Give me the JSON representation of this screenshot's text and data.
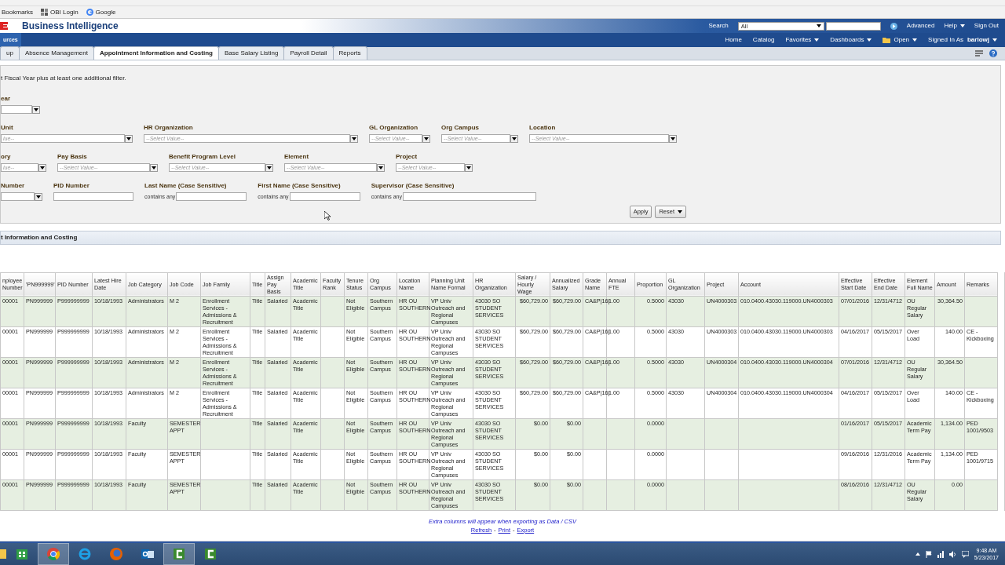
{
  "bookmarks": [
    {
      "label": "Bookmarks",
      "kind": "plain"
    },
    {
      "label": "OBI Login",
      "kind": "grid"
    },
    {
      "label": "Google",
      "kind": "google"
    }
  ],
  "header": {
    "title": "Business Intelligence",
    "search_label": "Search",
    "search_scope": "All",
    "links": [
      {
        "label": "Advanced",
        "menu": false
      },
      {
        "label": "Help",
        "menu": true
      },
      {
        "label": "Sign Out",
        "menu": false
      }
    ]
  },
  "nav": {
    "left": "urces",
    "items": [
      {
        "label": "Home",
        "menu": false
      },
      {
        "label": "Catalog",
        "menu": false
      },
      {
        "label": "Favorites",
        "menu": true
      },
      {
        "label": "Dashboards",
        "menu": true
      },
      {
        "label": "Open",
        "menu": true
      },
      {
        "label": "Signed In As",
        "menu": false
      }
    ],
    "user": "barlowj"
  },
  "tabs": [
    {
      "label": "up",
      "selected": false
    },
    {
      "label": "Absence Management",
      "selected": false
    },
    {
      "label": "Appointment Information and Costing",
      "selected": true
    },
    {
      "label": "Base Salary Listing",
      "selected": false
    },
    {
      "label": "Payroll Detail",
      "selected": false
    },
    {
      "label": "Reports",
      "selected": false
    }
  ],
  "instruction": "t Fiscal Year plus at least one additional filter.",
  "filters": [
    [
      {
        "label": "ear",
        "kind": "select"
      }
    ],
    [
      {
        "label": "Unit",
        "kind": "select",
        "placeholder": "lue--"
      },
      {
        "label": "HR Organization",
        "kind": "select",
        "placeholder": "--Select Value--"
      },
      {
        "label": "GL Organization",
        "kind": "select",
        "placeholder": "--Select Value--"
      },
      {
        "label": "Org Campus",
        "kind": "select",
        "placeholder": "--Select Value--"
      },
      {
        "label": "Location",
        "kind": "select",
        "placeholder": "--Select Value--"
      }
    ],
    [
      {
        "label": "ory",
        "kind": "select",
        "placeholder": "lue--"
      },
      {
        "label": "Pay Basis",
        "kind": "select",
        "placeholder": "--Select Value--"
      },
      {
        "label": "Benefit Program Level",
        "kind": "select",
        "placeholder": "--Select Value--"
      },
      {
        "label": "Element",
        "kind": "select",
        "placeholder": "--Select Value--"
      },
      {
        "label": "Project",
        "kind": "select",
        "placeholder": "--Select Value--"
      }
    ],
    [
      {
        "label": "Number",
        "kind": "select"
      },
      {
        "label": "PID Number",
        "kind": "text"
      },
      {
        "label": "Last Name (Case Sensitive)",
        "kind": "contains",
        "operator": "contains any"
      },
      {
        "label": "First Name (Case Sensitive)",
        "kind": "contains",
        "operator": "contains any"
      },
      {
        "label": "Supervisor (Case Sensitive)",
        "kind": "contains",
        "operator": "contains any"
      }
    ]
  ],
  "buttons": [
    {
      "label": "Apply",
      "menu": false
    },
    {
      "label": "Reset",
      "menu": true
    }
  ],
  "section_title": "t Information and Costing",
  "table": {
    "columns": [
      "nployee Number",
      "'PN999999'",
      "PID Number",
      "Latest Hire Date",
      "Job Category",
      "Job Code",
      "Job Family",
      "Title",
      "Assign Pay Basis",
      "Academic Title",
      "Faculty Rank",
      "Tenure Status",
      "Org Campus",
      "Location Name",
      "Planning Unit Name Formal",
      "HR Organization",
      "Salary / Hourly Wage",
      "Annualized Salary",
      "Grade Name",
      "Annual FTE",
      "Proportion",
      "GL Organization",
      "Project",
      "Account",
      "Effective Start Date",
      "Effective End Date",
      "Element Full Name",
      "Amount",
      "Remarks"
    ],
    "rows": [
      [
        "00001",
        "PN999999",
        "P999999999",
        "10/18/1993",
        "Administrators",
        "M 2",
        "Enrollment Services - Admissions & Recruitment",
        "Title",
        "Salaried",
        "Academic Title",
        null,
        "Not Eligible",
        "Southern Campus",
        "HR OU SOUTHERN",
        "VP Univ Outreach and Regional Campuses",
        "43030 SO STUDENT SERVICES",
        "$60,729.00",
        "$60,729.00",
        "CA&P|16|",
        "1.00",
        "0.5000",
        "43030",
        "UN4000303",
        "010.0400.43030.119000.UN4000303",
        "07/01/2016",
        "12/31/4712",
        "OU Regular Salary",
        "30,364.50",
        null
      ],
      [
        "00001",
        "PN999999",
        "P999999999",
        "10/18/1993",
        "Administrators",
        "M 2",
        "Enrollment Services - Admissions & Recruitment",
        "Title",
        "Salaried",
        "Academic Title",
        null,
        "Not Eligible",
        "Southern Campus",
        "HR OU SOUTHERN",
        "VP Univ Outreach and Regional Campuses",
        "43030 SO STUDENT SERVICES",
        "$60,729.00",
        "$60,729.00",
        "CA&P|16|",
        "1.00",
        "0.5000",
        "43030",
        "UN4000303",
        "010.0400.43030.119000.UN4000303",
        "04/16/2017",
        "05/15/2017",
        "Over Load",
        "140.00",
        "CE - Kickboxing"
      ],
      [
        "00001",
        "PN999999",
        "P999999999",
        "10/18/1993",
        "Administrators",
        "M 2",
        "Enrollment Services - Admissions & Recruitment",
        "Title",
        "Salaried",
        "Academic Title",
        null,
        "Not Eligible",
        "Southern Campus",
        "HR OU SOUTHERN",
        "VP Univ Outreach and Regional Campuses",
        "43030 SO STUDENT SERVICES",
        "$60,729.00",
        "$60,729.00",
        "CA&P|16|",
        "1.00",
        "0.5000",
        "43030",
        "UN4000304",
        "010.0400.43030.119000.UN4000304",
        "07/01/2016",
        "12/31/4712",
        "OU Regular Salary",
        "30,364.50",
        null
      ],
      [
        "00001",
        "PN999999",
        "P999999999",
        "10/18/1993",
        "Administrators",
        "M 2",
        "Enrollment Services - Admissions & Recruitment",
        "Title",
        "Salaried",
        "Academic Title",
        null,
        "Not Eligible",
        "Southern Campus",
        "HR OU SOUTHERN",
        "VP Univ Outreach and Regional Campuses",
        "43030 SO STUDENT SERVICES",
        "$60,729.00",
        "$60,729.00",
        "CA&P|16|",
        "1.00",
        "0.5000",
        "43030",
        "UN4000304",
        "010.0400.43030.119000.UN4000304",
        "04/16/2017",
        "05/15/2017",
        "Over Load",
        "140.00",
        "CE - Kickboxing"
      ],
      [
        "00001",
        "PN999999",
        "P999999999",
        "10/18/1993",
        "Faculty",
        "SEMESTER APPT",
        null,
        "Title",
        "Salaried",
        "Academic Title",
        null,
        "Not Eligible",
        "Southern Campus",
        "HR OU SOUTHERN",
        "VP Univ Outreach and Regional Campuses",
        "43030 SO STUDENT SERVICES",
        "$0.00",
        "$0.00",
        null,
        null,
        "0.0000",
        null,
        null,
        null,
        "01/16/2017",
        "05/15/2017",
        "Academic Term Pay",
        "1,134.00",
        "PED 1001/9503"
      ],
      [
        "00001",
        "PN999999",
        "P999999999",
        "10/18/1993",
        "Faculty",
        "SEMESTER APPT",
        null,
        "Title",
        "Salaried",
        "Academic Title",
        null,
        "Not Eligible",
        "Southern Campus",
        "HR OU SOUTHERN",
        "VP Univ Outreach and Regional Campuses",
        "43030 SO STUDENT SERVICES",
        "$0.00",
        "$0.00",
        null,
        null,
        "0.0000",
        null,
        null,
        null,
        "09/16/2016",
        "12/31/2016",
        "Academic Term Pay",
        "1,134.00",
        "PED 1001/9715"
      ],
      [
        "00001",
        "PN999999",
        "P999999999",
        "10/18/1993",
        "Faculty",
        "SEMESTER APPT",
        null,
        "Title",
        "Salaried",
        "Academic Title",
        null,
        "Not Eligible",
        "Southern Campus",
        "HR OU SOUTHERN",
        "VP Univ Outreach and Regional Campuses",
        "43030 SO STUDENT SERVICES",
        "$0.00",
        "$0.00",
        null,
        null,
        "0.0000",
        null,
        null,
        null,
        "08/16/2016",
        "12/31/4712",
        "OU Regular Salary",
        "0.00",
        null
      ]
    ]
  },
  "note": "Extra columns will appear when exporting as Data / CSV",
  "footer_links": [
    {
      "kind": "link",
      "text": "Refresh"
    },
    {
      "kind": "separator",
      "text": "-"
    },
    {
      "kind": "link",
      "text": "Print"
    },
    {
      "kind": "separator",
      "text": "-"
    },
    {
      "kind": "link",
      "text": "Export"
    }
  ],
  "taskbar": {
    "apps": [
      {
        "kind": "store",
        "selected": false
      },
      {
        "kind": "chrome",
        "selected": true
      },
      {
        "kind": "ie",
        "selected": false
      },
      {
        "kind": "firefox",
        "selected": false
      },
      {
        "kind": "outlook",
        "selected": false
      },
      {
        "kind": "camtasia",
        "selected": true
      },
      {
        "kind": "camtasia",
        "selected": false
      }
    ],
    "time": "9:48 AM",
    "date": "5/23/2017"
  }
}
